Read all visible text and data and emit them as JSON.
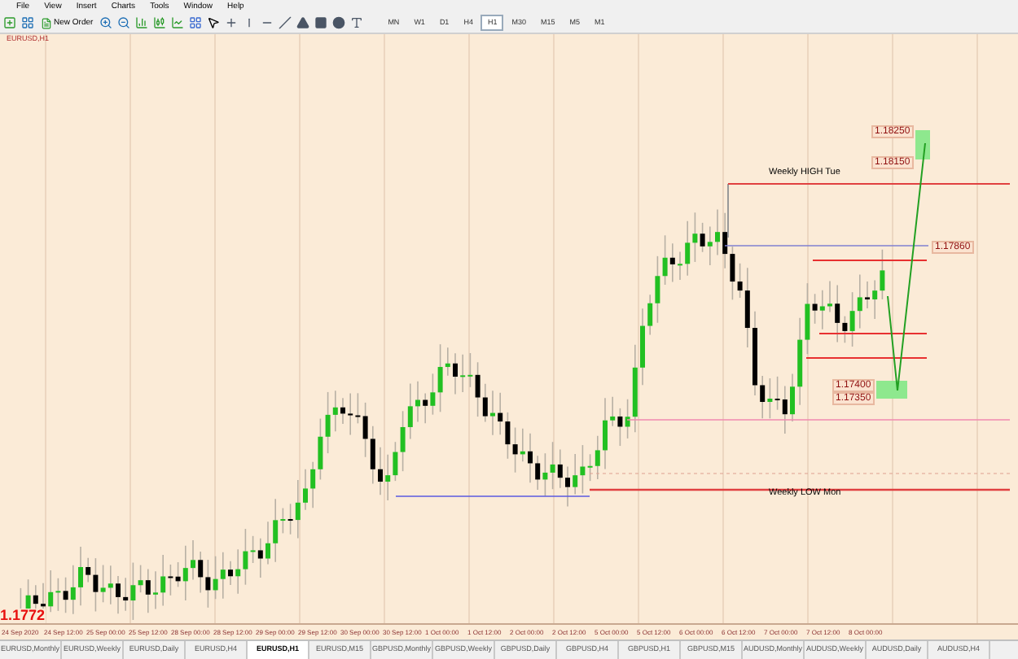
{
  "menu": [
    {
      "label": "File"
    },
    {
      "label": "View"
    },
    {
      "label": "Insert"
    },
    {
      "label": "Charts"
    },
    {
      "label": "Tools"
    },
    {
      "label": "Window"
    },
    {
      "label": "Help"
    }
  ],
  "toolbar": {
    "new_order": "New Order",
    "timeframes": [
      {
        "label": "MN",
        "selected": false
      },
      {
        "label": "W1",
        "selected": false
      },
      {
        "label": "D1",
        "selected": false
      },
      {
        "label": "H4",
        "selected": false
      },
      {
        "label": "H1",
        "selected": true
      },
      {
        "label": "M30",
        "selected": false
      },
      {
        "label": "M15",
        "selected": false
      },
      {
        "label": "M5",
        "selected": false
      },
      {
        "label": "M1",
        "selected": false
      }
    ]
  },
  "chart": {
    "symbol_label": "EURUSD,H1",
    "current_price": "1.1772",
    "line_labels": [
      {
        "text": "Weekly HIGH Tue"
      },
      {
        "text": "Weekly LOW Mon"
      }
    ],
    "price_tags": [
      {
        "text": "1.18250"
      },
      {
        "text": "1.18150"
      },
      {
        "text": "1.17860"
      },
      {
        "text": "1.17400"
      },
      {
        "text": "1.17350"
      }
    ],
    "time_axis": [
      "24 Sep 2020",
      "24 Sep 12:00",
      "25 Sep 00:00",
      "25 Sep 12:00",
      "28 Sep 00:00",
      "28 Sep 12:00",
      "29 Sep 00:00",
      "29 Sep 12:00",
      "30 Sep 00:00",
      "30 Sep 12:00",
      "1 Oct 00:00",
      "1 Oct 12:00",
      "2 Oct 00:00",
      "2 Oct 12:00",
      "5 Oct 00:00",
      "5 Oct 12:00",
      "6 Oct 00:00",
      "6 Oct 12:00",
      "7 Oct 00:00",
      "7 Oct 12:00",
      "8 Oct 00:00"
    ]
  },
  "tabs": [
    {
      "label": "EURUSD,Monthly",
      "selected": false
    },
    {
      "label": "EURUSD,Weekly",
      "selected": false
    },
    {
      "label": "EURUSD,Daily",
      "selected": false
    },
    {
      "label": "EURUSD,H4",
      "selected": false
    },
    {
      "label": "EURUSD,H1",
      "selected": true
    },
    {
      "label": "EURUSD,M15",
      "selected": false
    },
    {
      "label": "GBPUSD,Monthly",
      "selected": false
    },
    {
      "label": "GBPUSD,Weekly",
      "selected": false
    },
    {
      "label": "GBPUSD,Daily",
      "selected": false
    },
    {
      "label": "GBPUSD,H4",
      "selected": false
    },
    {
      "label": "GBPUSD,H1",
      "selected": false
    },
    {
      "label": "GBPUSD,M15",
      "selected": false
    },
    {
      "label": "AUDUSD,Monthly",
      "selected": false
    },
    {
      "label": "AUDUSD,Weekly",
      "selected": false
    },
    {
      "label": "AUDUSD,Daily",
      "selected": false
    },
    {
      "label": "AUDUSD,H4",
      "selected": false
    }
  ]
}
